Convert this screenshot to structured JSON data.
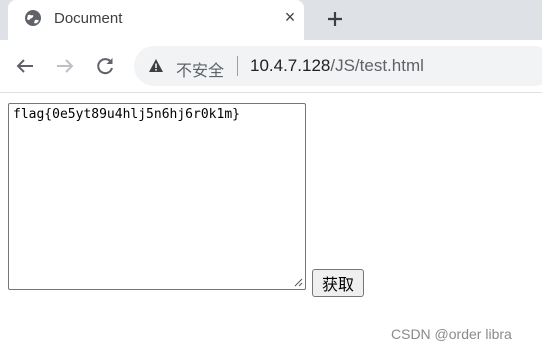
{
  "tab": {
    "title": "Document",
    "close_glyph": "×",
    "globe_icon": "globe-icon",
    "new_tab_icon": "plus-icon"
  },
  "toolbar": {
    "back_icon": "back-arrow-icon",
    "forward_icon": "forward-arrow-icon",
    "reload_icon": "reload-icon",
    "security_icon": "warning-icon",
    "security_text": "不安全",
    "url_host": "10.4.7.128",
    "url_path": "/JS/test.html"
  },
  "page": {
    "textarea_value": "flag{0e5yt89u4hlj5n6hj6r0k1m}",
    "button_label": "获取"
  },
  "watermark": "CSDN @order libra",
  "colors": {
    "tabstrip": "#dee1e6",
    "omnibox": "#f1f3f4",
    "button_bg": "#efefef"
  }
}
